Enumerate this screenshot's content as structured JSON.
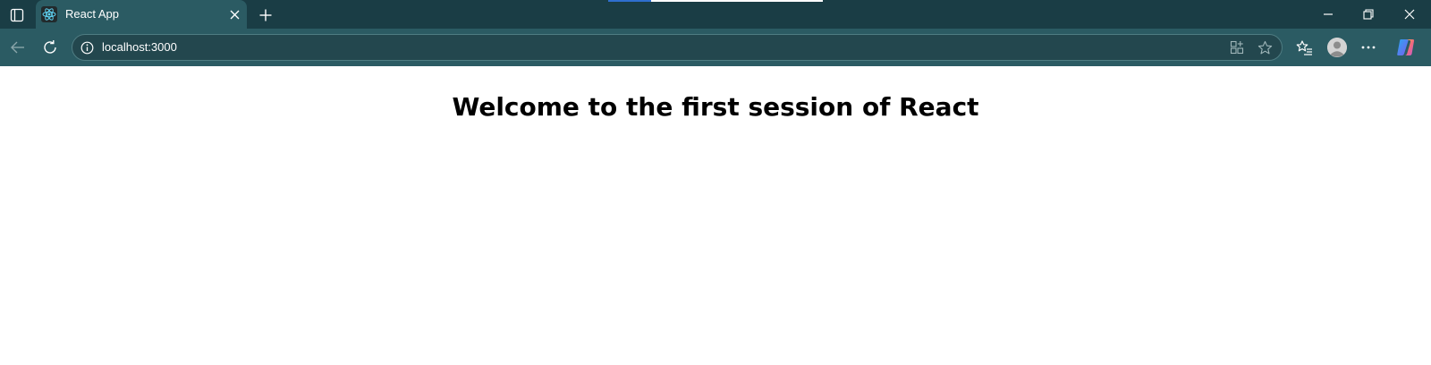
{
  "tab": {
    "title": "React App",
    "favicon": "react-logo-icon"
  },
  "address_bar": {
    "url": "localhost:3000"
  },
  "page": {
    "heading": "Welcome to the first session of React"
  },
  "colors": {
    "tabstrip": "#1a3d45",
    "toolbar": "#2b5b63",
    "omnibox": "#23474e",
    "react_cyan": "#61dafb"
  },
  "icons": {
    "tab_actions": "tab-actions-icon",
    "tab_close": "close-icon",
    "new_tab": "plus-icon",
    "minimize": "minimize-icon",
    "restore": "restore-icon",
    "close_window": "close-icon",
    "back": "back-arrow-icon",
    "refresh": "refresh-icon",
    "site_info": "info-icon",
    "app_available": "app-available-icon",
    "favorite": "star-icon",
    "favorites": "favorites-icon",
    "profile": "profile-avatar-icon",
    "more": "more-icon",
    "copilot": "copilot-icon"
  }
}
